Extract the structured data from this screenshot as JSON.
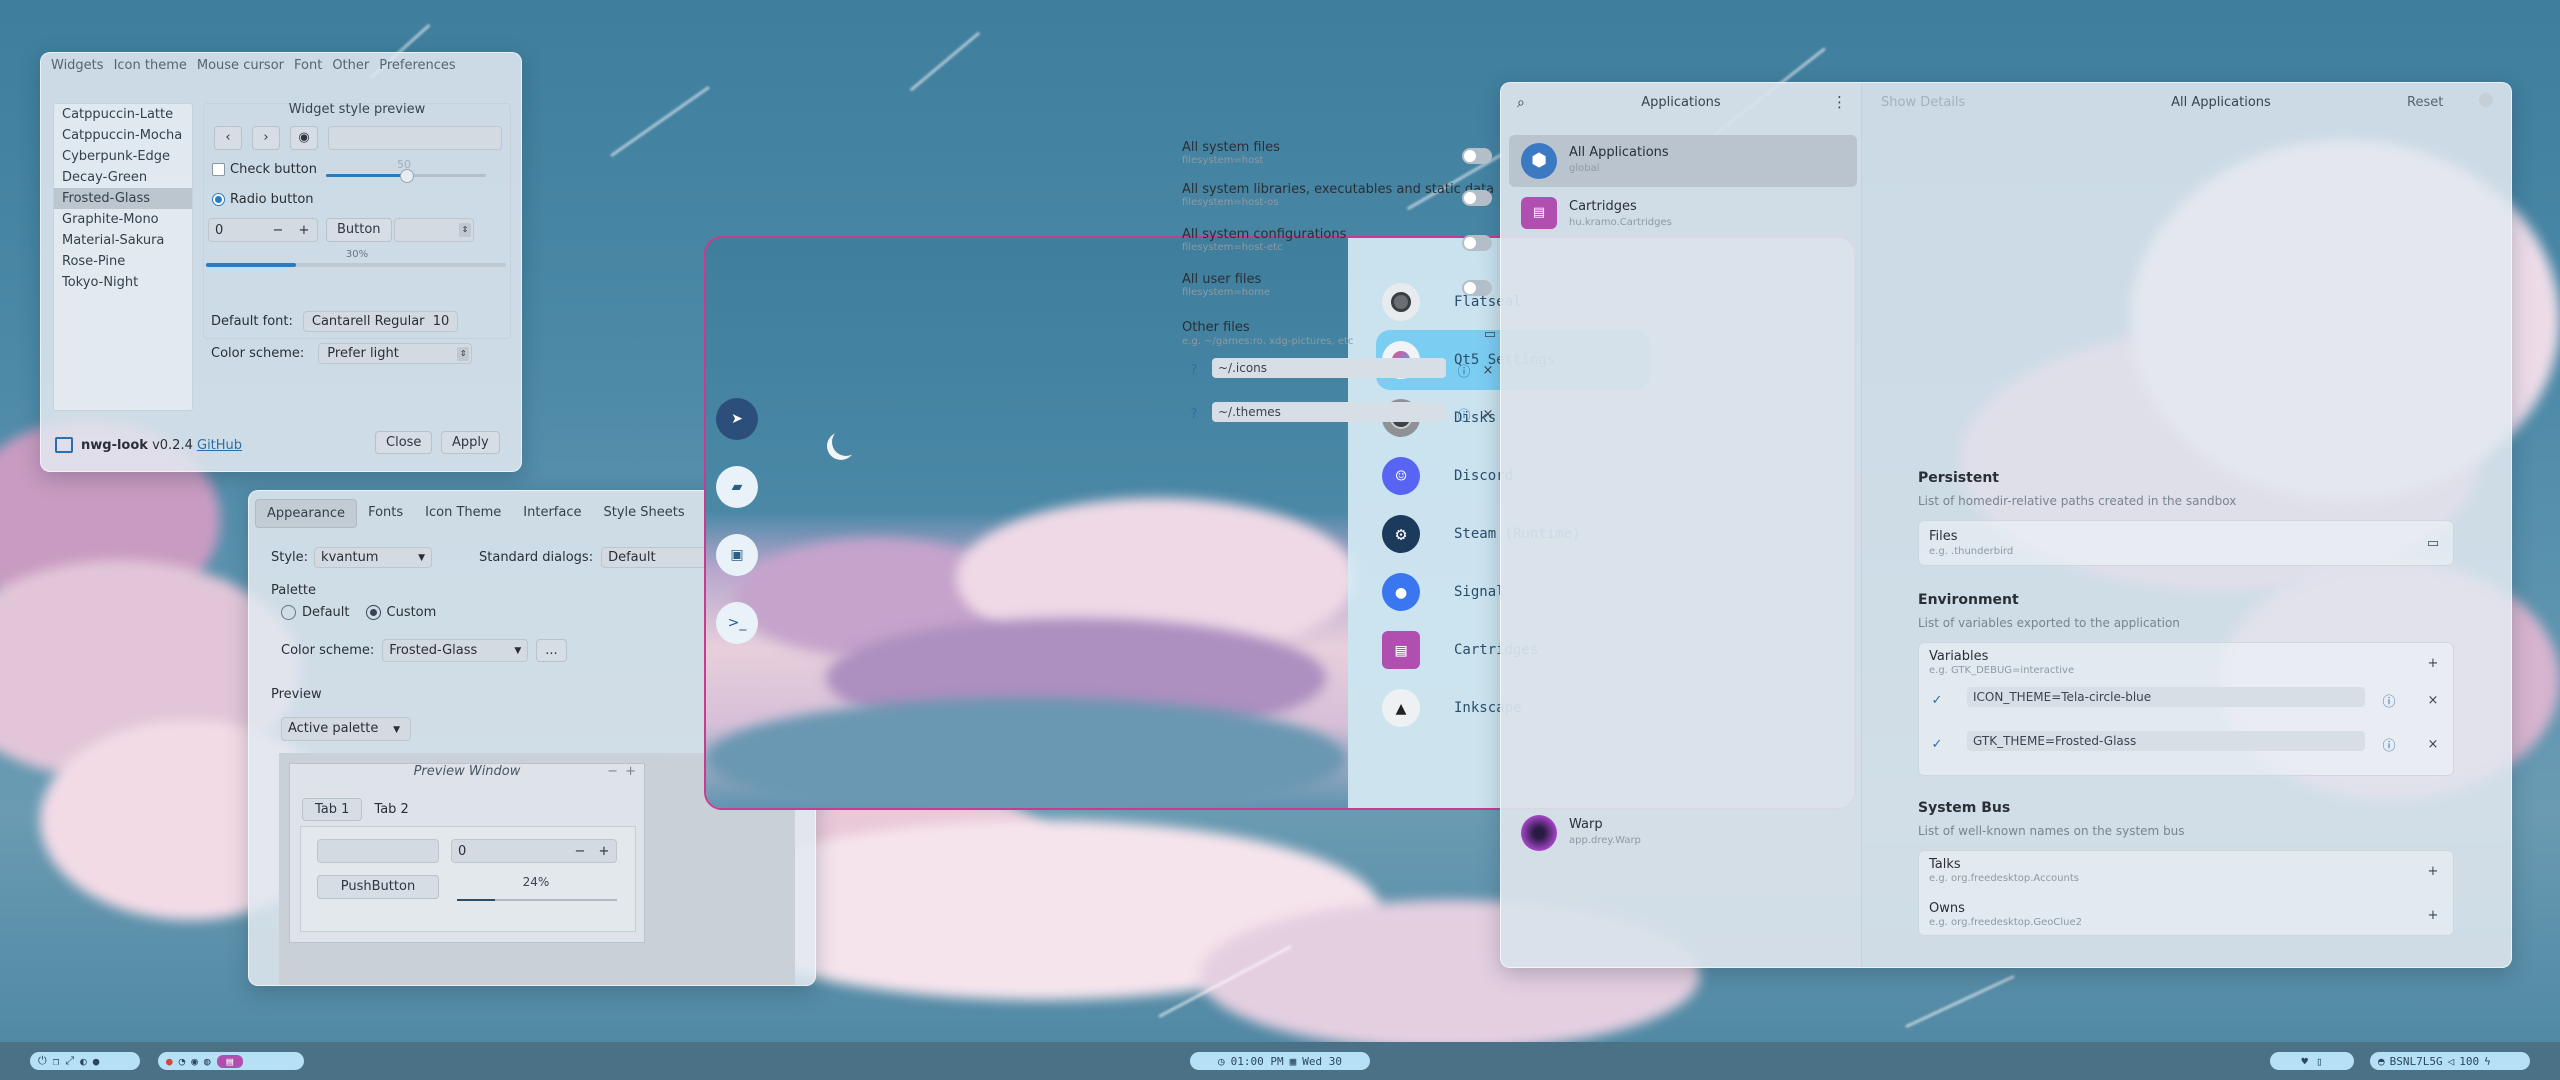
{
  "nwg": {
    "menu": [
      "Widgets",
      "Icon theme",
      "Mouse cursor",
      "Font",
      "Other",
      "Preferences"
    ],
    "themes": [
      "Catppuccin-Latte",
      "Catppuccin-Mocha",
      "Cyberpunk-Edge",
      "Decay-Green",
      "Frosted-Glass",
      "Graphite-Mono",
      "Material-Sakura",
      "Rose-Pine",
      "Tokyo-Night"
    ],
    "selected_theme": "Frosted-Glass",
    "preview_title": "Widget style preview",
    "check_label": "Check button",
    "radio_label": "Radio button",
    "slider_value": "50",
    "spin_value": "0",
    "button_label": "Button",
    "progress_label": "30%",
    "progress": 0.3,
    "font_label": "Default font:",
    "font_value": "Cantarell Regular",
    "font_size": "10",
    "scheme_label": "Color scheme:",
    "scheme_value": "Prefer light",
    "app_name": "nwg-look",
    "version": "v0.2.4",
    "link": "GitHub",
    "close": "Close",
    "apply": "Apply"
  },
  "qt": {
    "tabs": [
      "Appearance",
      "Fonts",
      "Icon Theme",
      "Interface",
      "Style Sheets"
    ],
    "style_label": "Style:",
    "style_value": "kvantum",
    "dialogs_label": "Standard dialogs:",
    "dialogs_value": "Default",
    "palette_label": "Palette",
    "default_label": "Default",
    "custom_label": "Custom",
    "scheme_label": "Color scheme:",
    "scheme_value": "Frosted-Glass",
    "more": "...",
    "preview_label": "Preview",
    "active_palette": "Active palette",
    "preview_window": "Preview Window",
    "tab1": "Tab 1",
    "tab2": "Tab 2",
    "spin": "0",
    "push": "PushButton",
    "progress_label": "24%",
    "progress": 0.24
  },
  "launcher": {
    "apps": [
      {
        "name": "Flatseal",
        "color": "#6b6f73"
      },
      {
        "name": "Qt5 Settings",
        "color": "#f0f4f8"
      },
      {
        "name": "Disks",
        "color": "#8a8e92"
      },
      {
        "name": "Discord",
        "color": "#5865f2"
      },
      {
        "name": "Steam (Runtime)",
        "color": "#1b3a5c"
      },
      {
        "name": "Signal",
        "color": "#3a76f0"
      },
      {
        "name": "Cartridges",
        "color": "#b04fb0"
      },
      {
        "name": "Inkscape",
        "color": "#e8ecef"
      }
    ],
    "selected": "Qt5 Settings",
    "dock_icons": [
      "arrow-icon",
      "folder-icon",
      "window-icon",
      "terminal-icon"
    ]
  },
  "flatseal": {
    "sidebar_title": "Applications",
    "show_details": "Show Details",
    "main_title": "All Applications",
    "reset": "Reset",
    "apps": [
      {
        "name": "All Applications",
        "sub": "global"
      },
      {
        "name": "Cartridges",
        "sub": "hu.kramo.Cartridges"
      },
      {
        "name": "Warp",
        "sub": "app.drey.Warp"
      }
    ],
    "filesystem": [
      {
        "title": "All system files",
        "sub": "filesystem=host"
      },
      {
        "title": "All system libraries, executables and static data",
        "sub": "filesystem=host-os"
      },
      {
        "title": "All system configurations",
        "sub": "filesystem=host-etc"
      },
      {
        "title": "All user files",
        "sub": "filesystem=home"
      }
    ],
    "other_files": "Other files",
    "other_files_hint": "e.g. ~/games:ro, xdg-pictures, etc",
    "other_paths": [
      "~/.icons",
      "~/.themes"
    ],
    "persistent_title": "Persistent",
    "persistent_desc": "List of homedir-relative paths created in the sandbox",
    "files_label": "Files",
    "files_hint": "e.g. .thunderbird",
    "env_title": "Environment",
    "env_desc": "List of variables exported to the application",
    "variables_label": "Variables",
    "variables_hint": "e.g. GTK_DEBUG=interactive",
    "variables": [
      "ICON_THEME=Tela-circle-blue",
      "GTK_THEME=Frosted-Glass"
    ],
    "bus_title": "System Bus",
    "bus_desc": "List of well-known names on the system bus",
    "talks_label": "Talks",
    "talks_hint": "e.g. org.freedesktop.Accounts",
    "owns_label": "Owns",
    "owns_hint": "e.g. org.freedesktop.GeoClue2"
  },
  "taskbar": {
    "clock": "01:00 PM",
    "date": "Wed 30",
    "network": "BSNL7L5G",
    "volume": "100"
  },
  "colors": {
    "accent_pink": "#c83c8f",
    "launcher_select": "#7ccdf2",
    "pill": "#b6e0f5"
  }
}
